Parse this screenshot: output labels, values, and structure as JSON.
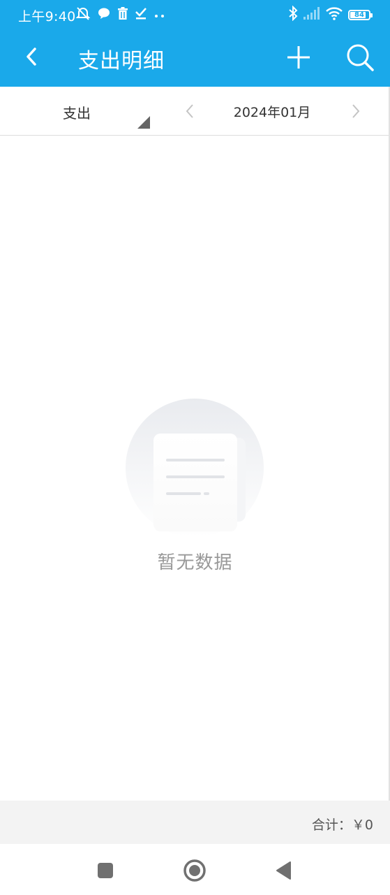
{
  "status_bar": {
    "time": "上午9:40",
    "battery": "84",
    "battery_level": 0.84,
    "icons": [
      "mute-alarm-icon",
      "chat-bubble-icon",
      "trash-icon",
      "check-icon",
      "more-dots-icon",
      "bluetooth-icon",
      "signal-icon",
      "wifi-icon",
      "battery-icon"
    ]
  },
  "appbar": {
    "title": "支出明细",
    "back_icon": "chevron-left-icon",
    "add_icon": "plus-icon",
    "search_icon": "search-icon"
  },
  "filter": {
    "type_label": "支出",
    "month_label": "2024年01月"
  },
  "empty_state": {
    "message": "暂无数据",
    "icon": "empty-document-icon"
  },
  "footer": {
    "total_label": "合计：",
    "total_value": "￥0"
  },
  "navbar": {
    "items": [
      "recents-square-icon",
      "home-circle-icon",
      "back-triangle-icon"
    ]
  },
  "colors": {
    "primary": "#1aa9ea",
    "text_dark": "#333333",
    "text_muted": "#999999",
    "footer_bg": "#f3f3f3"
  }
}
